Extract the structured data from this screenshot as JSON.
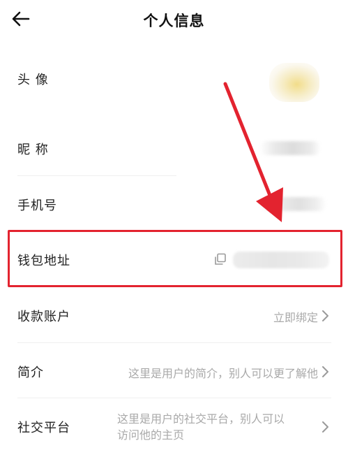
{
  "header": {
    "title": "个人信息"
  },
  "rows": {
    "avatar": {
      "label": "头 像"
    },
    "nickname": {
      "label": "昵 称"
    },
    "phone": {
      "label": "手机号"
    },
    "wallet": {
      "label": "钱包地址"
    },
    "payment": {
      "label": "收款账户",
      "action": "立即绑定"
    },
    "bio": {
      "label": "简介",
      "value": "这里是用户的简介，别人可以更了解他"
    },
    "social": {
      "label": "社交平台",
      "value_line1": "这里是用户的社交平台，别人可以",
      "value_line2": "访问他的主页"
    }
  },
  "colors": {
    "highlight": "#e3232f",
    "muted_text": "#a9a9a9",
    "divider": "#efefef"
  },
  "icons": {
    "back": "arrow-left-icon",
    "copy": "copy-icon",
    "chevron": "chevron-right-icon"
  }
}
